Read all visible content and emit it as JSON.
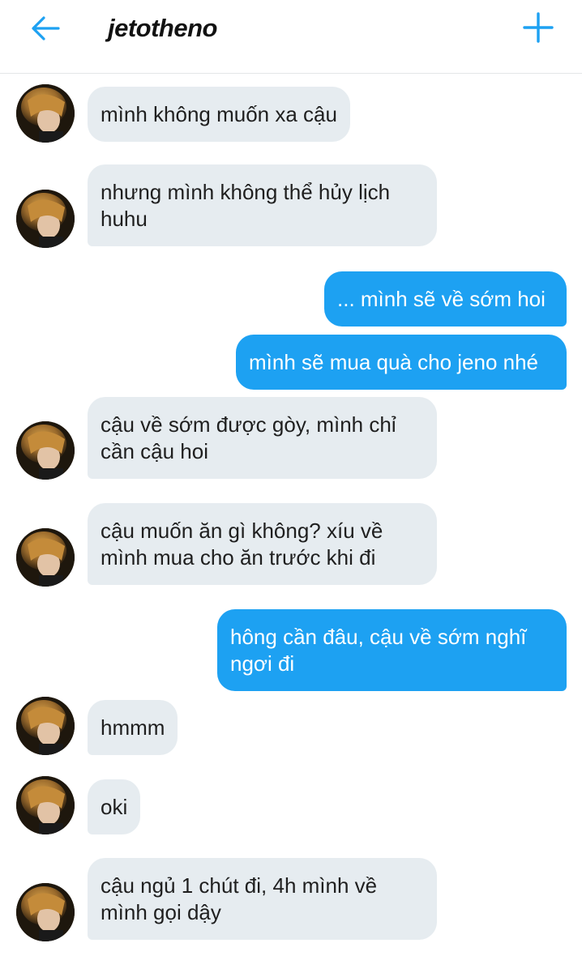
{
  "header": {
    "title": "jetotheno",
    "back_icon": "arrow-left-icon",
    "add_icon": "plus-icon",
    "accent_color": "#1da1f2"
  },
  "messages": [
    {
      "side": "in",
      "lines": [
        "mình không muốn xa cậu"
      ]
    },
    {
      "side": "in",
      "lines": [
        "nhưng mình không thể hủy lịch",
        "huhu"
      ]
    },
    {
      "side": "out",
      "lines": [
        "... mình sẽ về sớm hoi"
      ]
    },
    {
      "side": "out",
      "lines": [
        "mình sẽ mua quà cho jeno nhé"
      ]
    },
    {
      "side": "in",
      "lines": [
        "cậu về sớm được gòy, mình chỉ",
        "cần cậu hoi"
      ]
    },
    {
      "side": "in",
      "lines": [
        "cậu muốn ăn gì không? xíu về",
        "mình mua cho ăn trước khi đi"
      ]
    },
    {
      "side": "out",
      "lines": [
        "hông cần đâu, cậu về sớm nghĩ",
        "ngơi đi"
      ]
    },
    {
      "side": "in",
      "lines": [
        "hmmm"
      ]
    },
    {
      "side": "in",
      "lines": [
        "oki"
      ]
    },
    {
      "side": "in",
      "lines": [
        "cậu ngủ 1 chút đi, 4h mình về",
        "mình gọi dậy"
      ]
    }
  ],
  "colors": {
    "incoming_bubble": "#e6ecf0",
    "outgoing_bubble": "#1da1f2"
  }
}
